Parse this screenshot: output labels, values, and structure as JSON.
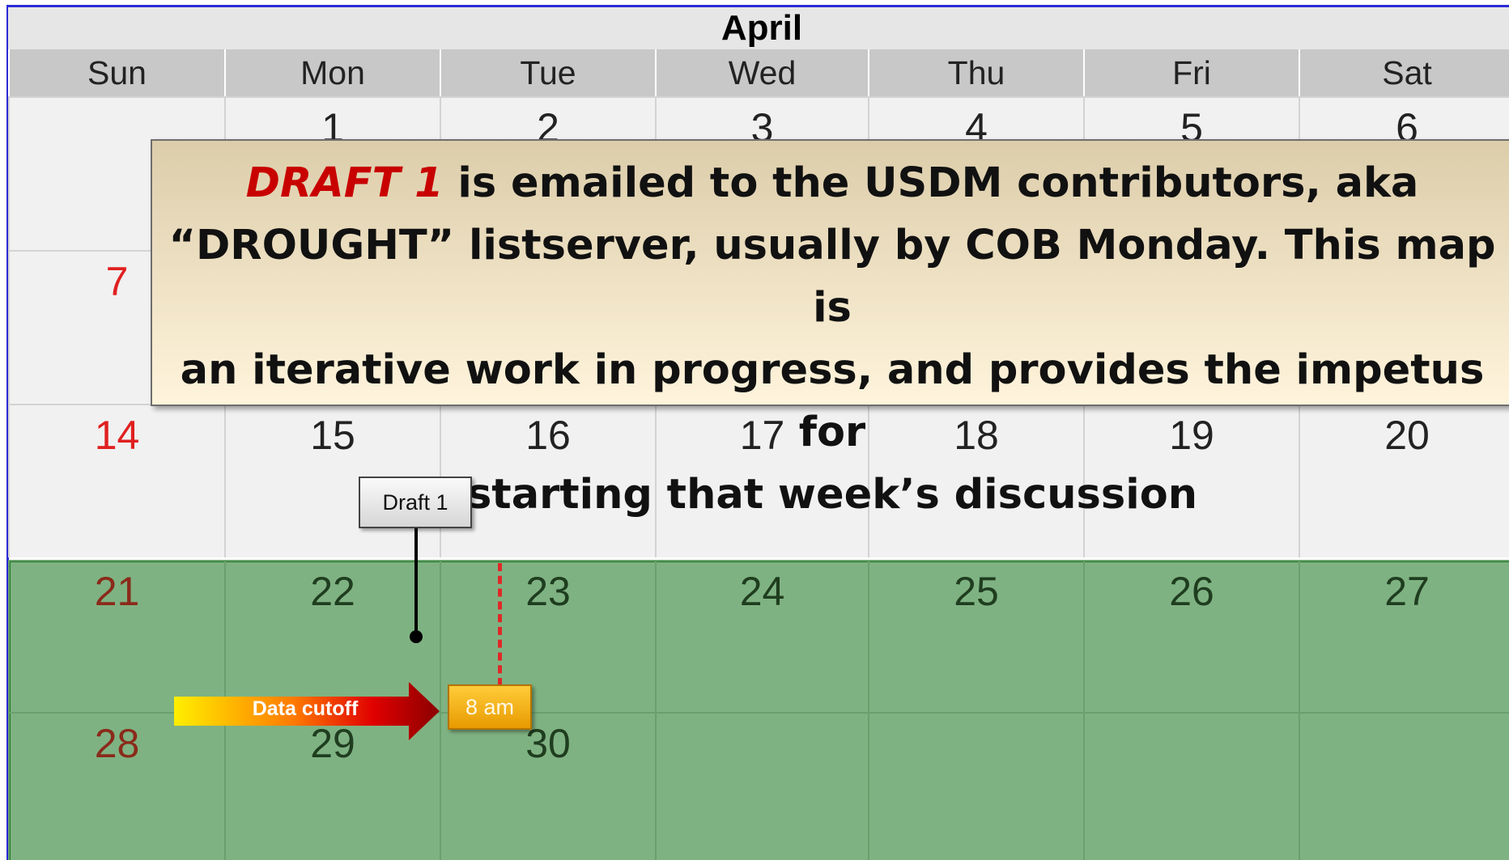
{
  "calendar": {
    "month": "April",
    "days_of_week": [
      "Sun",
      "Mon",
      "Tue",
      "Wed",
      "Thu",
      "Fri",
      "Sat"
    ],
    "weeks": [
      [
        "",
        "1",
        "2",
        "3",
        "4",
        "5",
        "6"
      ],
      [
        "7",
        "",
        "",
        "",
        "",
        "",
        ""
      ],
      [
        "14",
        "15",
        "16",
        "17",
        "18",
        "19",
        "20"
      ],
      [
        "21",
        "22",
        "23",
        "24",
        "25",
        "26",
        "27"
      ],
      [
        "28",
        "29",
        "30",
        "",
        "",
        "",
        ""
      ]
    ]
  },
  "callout": {
    "highlight": "DRAFT 1",
    "line1_rest": " is emailed to the USDM contributors, aka",
    "line2": "“DROUGHT” listserver, usually by COB Monday.  This map is",
    "line3": "an iterative work in progress, and provides the impetus for",
    "line4": "starting that week’s discussion"
  },
  "draft_marker": {
    "label": "Draft 1"
  },
  "data_cutoff": {
    "label": "Data cutoff"
  },
  "time_marker": {
    "label": "8 am"
  },
  "colors": {
    "frame": "#2b2bd6",
    "highlight_text": "#c80000",
    "green_overlay": "#7fb282",
    "green_border": "#1c7a25",
    "cutoff_dash": "#e02828",
    "time_tag": "#ffb81c"
  }
}
